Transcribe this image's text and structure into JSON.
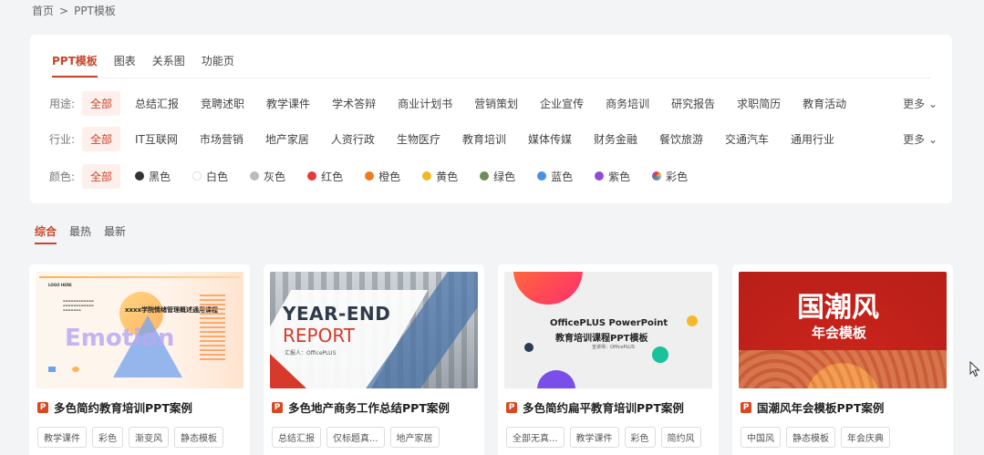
{
  "breadcrumb": {
    "home": "首页",
    "sep": ">",
    "current": "PPT模板"
  },
  "tabs": [
    "PPT模板",
    "图表",
    "关系图",
    "功能页"
  ],
  "usage": {
    "label": "用途:",
    "all": "全部",
    "items": [
      "总结汇报",
      "竞聘述职",
      "教学课件",
      "学术答辩",
      "商业计划书",
      "营销策划",
      "企业宣传",
      "商务培训",
      "研究报告",
      "求职简历",
      "教育活动"
    ],
    "more": "更多 ⌄"
  },
  "industry": {
    "label": "行业:",
    "all": "全部",
    "items": [
      "IT互联网",
      "市场营销",
      "地产家居",
      "人资行政",
      "生物医疗",
      "教育培训",
      "媒体传媒",
      "财务金融",
      "餐饮旅游",
      "交通汽车",
      "通用行业"
    ],
    "more": "更多 ⌄"
  },
  "colors": {
    "label": "颜色:",
    "all": "全部",
    "items": [
      {
        "name": "黑色",
        "hex": "#333333"
      },
      {
        "name": "白色",
        "hex": "#ffffff"
      },
      {
        "name": "灰色",
        "hex": "#bbbbbb"
      },
      {
        "name": "红色",
        "hex": "#e83a3a"
      },
      {
        "name": "橙色",
        "hex": "#f07a22"
      },
      {
        "name": "黄色",
        "hex": "#f2b822"
      },
      {
        "name": "绿色",
        "hex": "#6b8e5a"
      },
      {
        "name": "蓝色",
        "hex": "#4a90e2"
      },
      {
        "name": "紫色",
        "hex": "#8e4ad9"
      },
      {
        "name": "彩色",
        "hex": "multicolor"
      }
    ]
  },
  "sort_tabs": [
    "综合",
    "最热",
    "最新"
  ],
  "cards": [
    {
      "title": "多色简约教育培训PPT案例",
      "tags": [
        "教学课件",
        "彩色",
        "渐变风",
        "静态模板"
      ],
      "thumb": {
        "logo": "LOGO HERE",
        "heading": "xxxx学院情绪管理概述通用课程",
        "big": "Emotion"
      }
    },
    {
      "title": "多色地产商务工作总结PPT案例",
      "tags": [
        "总结汇报",
        "仅标题真...",
        "地产家居"
      ],
      "thumb": {
        "line1": "YEAR-END",
        "line2": "REPORT",
        "sub": "汇报人：OfficePLUS"
      }
    },
    {
      "title": "多色简约扁平教育培训PPT案例",
      "tags": [
        "全部无真...",
        "教学课件",
        "彩色",
        "简约风"
      ],
      "thumb": {
        "line1": "OfficePLUS PowerPoint",
        "line2": "教育培训课程PPT模板",
        "sub": "宣讲师：OfficePLUS"
      }
    },
    {
      "title": "国潮风年会模板PPT案例",
      "tags": [
        "中国风",
        "静态模板",
        "年会庆典"
      ],
      "thumb": {
        "line1": "国潮风",
        "line2": "年会模板"
      }
    }
  ]
}
